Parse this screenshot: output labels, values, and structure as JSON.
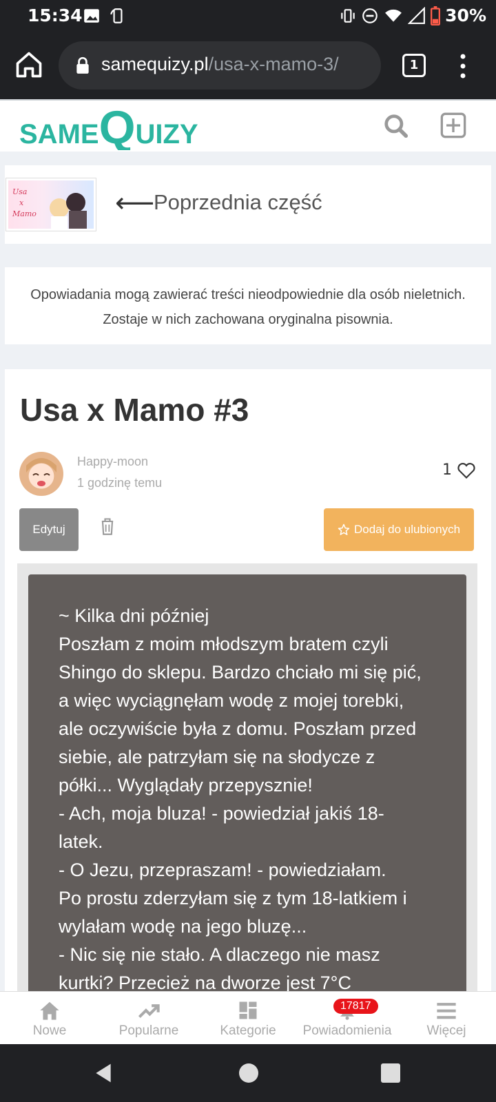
{
  "status_bar": {
    "time": "15:34",
    "battery": "30%",
    "icons": [
      "image-icon",
      "screen-rotate-icon",
      "vibrate-icon",
      "dnd-icon",
      "wifi-icon",
      "signal-icon",
      "battery-icon"
    ]
  },
  "browser": {
    "url_domain": "samequizy.pl",
    "url_path": "/usa-x-mamo-3/",
    "tab_count": "1"
  },
  "header": {
    "logo_text_1": "SAME",
    "logo_text_2": "Q",
    "logo_text_3": "UIZY",
    "brand_color": "#2bb5a0"
  },
  "prev_part": {
    "label": "Poprzednia część",
    "thumb_text_1": "Usa",
    "thumb_text_2": "x",
    "thumb_text_3": "Mamo"
  },
  "notice": {
    "line1": "Opowiadania mogą zawierać treści nieodpowiednie dla osób nieletnich.",
    "line2": "Zostaje w nich zachowana oryginalna pisownia."
  },
  "story": {
    "title": "Usa x Mamo #3",
    "author": "Happy-moon",
    "time_ago": "1 godzinę temu",
    "likes": "1",
    "edit_label": "Edytuj",
    "favorite_label": "Dodaj do ulubionych",
    "lines": [
      "~ Kilka dni później",
      "Poszłam z moim młodszym bratem czyli",
      "Shingo do sklepu. Bardzo chciało mi się pić,",
      "a więc wyciągnęłam wodę z mojej torebki,",
      "ale oczywiście była z domu. Poszłam przed",
      "siebie, ale patrzyłam się na słodycze z",
      "półki... Wyglądały przepysznie!",
      "- Ach, moja bluza! - powiedział jakiś 18-",
      "latek.",
      "- O Jezu, przepraszam! - powiedziałam.",
      "Po prostu zderzyłam się z tym 18-latkiem i",
      "wylałam wodę na jego bluzę...",
      "- Nic się nie stało. A dlaczego nie masz",
      "kurtki? Przecież na dworze jest 7°C"
    ]
  },
  "bottom_nav": {
    "items": [
      {
        "label": "Nowe",
        "icon": "home-icon"
      },
      {
        "label": "Popularne",
        "icon": "trending-icon"
      },
      {
        "label": "Kategorie",
        "icon": "grid-icon"
      },
      {
        "label": "Powiadomienia",
        "icon": "bell-icon"
      },
      {
        "label": "Więcej",
        "icon": "menu-icon"
      }
    ],
    "notification_count": "17817"
  }
}
